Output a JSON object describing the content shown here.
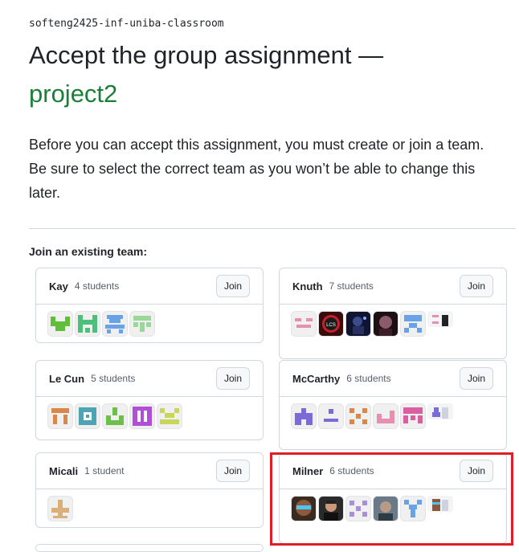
{
  "classroom": "softeng2425-inf-uniba-classroom",
  "title": "Accept the group assignment —",
  "assignment": "project2",
  "description": "Before you can accept this assignment, you must create or join a team. Be sure to select the correct team as you won’t be able to change this later.",
  "join_heading": "Join an existing team:",
  "join_label": "Join",
  "teams": [
    {
      "name": "Kay",
      "count": "4 students"
    },
    {
      "name": "Knuth",
      "count": "7 students"
    },
    {
      "name": "Le Cun",
      "count": "5 students"
    },
    {
      "name": "McCarthy",
      "count": "6 students"
    },
    {
      "name": "Micali",
      "count": "1 student"
    },
    {
      "name": "Milner",
      "count": "6 students"
    }
  ],
  "colors": {
    "accent_green": "#1a7f37",
    "highlight": "#e11d2a",
    "kay": [
      "#5fbf3a",
      "#5fbf3a",
      "#6aa2e8",
      "#9bd69b"
    ],
    "knuth": [
      "#e88fb0",
      "photo",
      "photo",
      "photo",
      "#6aa2e8",
      "#e88fb0"
    ],
    "lecun": [
      "#d9874a",
      "#4ea3b5",
      "#6dbf4a",
      "#b24fd8",
      "#c9d65a"
    ],
    "mccarthy": [
      "#7b6ad8",
      "#7b6ad8",
      "#d9874a",
      "#e88fb0",
      "#d95fa0",
      "#7b6ad8"
    ],
    "micali": [
      "#d9b07a"
    ],
    "milner": [
      "photo",
      "photo",
      "#a88fd8",
      "photo",
      "#6aa2e8",
      "photo"
    ]
  }
}
